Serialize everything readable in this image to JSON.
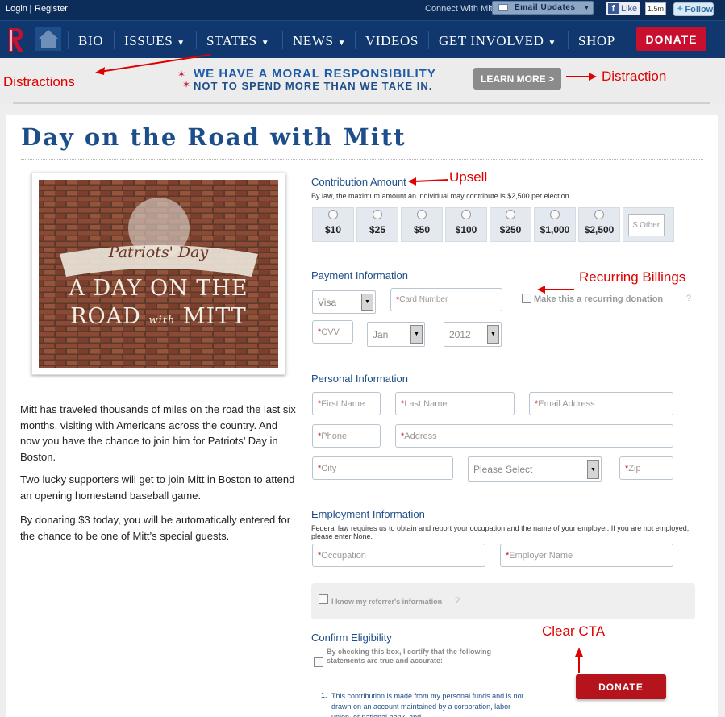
{
  "topbar": {
    "login": "Login",
    "separator": "|",
    "register": "Register",
    "connect_with": "Connect With Mitt",
    "email_updates": "Email Updates",
    "like": "Like",
    "like_count": "1.5m",
    "follow": "Follow"
  },
  "nav": {
    "items": [
      {
        "label": "BIO"
      },
      {
        "label": "ISSUES",
        "chevron": "▼"
      },
      {
        "label": "STATES",
        "chevron": "▼"
      },
      {
        "label": "NEWS",
        "chevron": "▼"
      },
      {
        "label": "VIDEOS"
      },
      {
        "label": "GET INVOLVED",
        "chevron": "▼"
      },
      {
        "label": "SHOP"
      }
    ],
    "donate": "DONATE"
  },
  "banner": {
    "line1": "WE HAVE A MORAL RESPONSIBILITY",
    "line2": "NOT TO SPEND MORE THAN WE TAKE IN.",
    "learn_more": "LEARN MORE >"
  },
  "annotations": {
    "distractions": "Distractions",
    "distraction": "Distraction",
    "upsell": "Upsell",
    "recurring": "Recurring Billings",
    "clear_cta": "Clear CTA"
  },
  "page": {
    "title": "Day on the Road with Mitt"
  },
  "poster": {
    "subtitle": "Patriots' Day",
    "line1": "A DAY ON THE",
    "line2a": "ROAD",
    "line2b": "with",
    "line2c": "MITT"
  },
  "description": {
    "p1": "Mitt has traveled thousands of miles on the road the last six months, visiting with Americans across the country. And now you have the chance to join him for Patriots’ Day in Boston.",
    "p2": "Two lucky supporters will get to join Mitt in Boston to attend an opening homestand baseball game.",
    "p3": "By donating $3 today, you will be automatically entered for the chance to be one of Mitt’s special guests."
  },
  "contribution": {
    "title": "Contribution Amount",
    "note": "By law, the maximum amount an individual may contribute is $2,500 per election.",
    "amounts": [
      "$10",
      "$25",
      "$50",
      "$100",
      "$250",
      "$1,000",
      "$2,500"
    ],
    "other_placeholder": "$ Other"
  },
  "payment": {
    "title": "Payment Information",
    "card_type": "Visa",
    "card_number": "Card Number",
    "recurring_label": "Make this a recurring donation",
    "help": "?",
    "cvv": "CVV",
    "month": "Jan",
    "year": "2012"
  },
  "personal": {
    "title": "Personal Information",
    "first_name": "First Name",
    "last_name": "Last Name",
    "email": "Email Address",
    "phone": "Phone",
    "address": "Address",
    "city": "City",
    "state": "Please Select",
    "zip": "Zip"
  },
  "employment": {
    "title": "Employment Information",
    "note": "Federal law requires us to obtain and report your occupation and the name of your employer. If you are not employed, please enter None.",
    "occupation": "Occupation",
    "employer": "Employer Name"
  },
  "referrer": {
    "label": "I know my referrer's information",
    "help": "?"
  },
  "eligibility": {
    "title": "Confirm Eligibility",
    "checkbox_label": "By checking this box, I certify that the following statements are true and accurate:",
    "item1_num": "1.",
    "item1": "This contribution is made from my personal funds and is not drawn on an account maintained by a corporation, labor union, or national bank; and"
  },
  "cta": {
    "donate": "DONATE"
  },
  "colors": {
    "navy": "#11386e",
    "red": "#c8102e",
    "annotation": "#e00000",
    "title": "#1d4e89"
  }
}
